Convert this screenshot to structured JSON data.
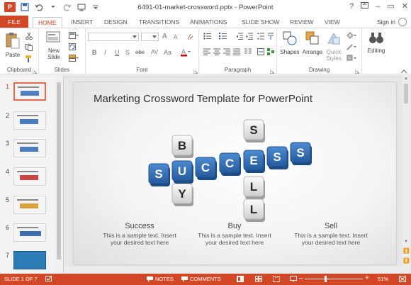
{
  "window": {
    "doc_title": "6491-01-market-crossword.pptx - PowerPoint",
    "help": "?",
    "minimize": "–",
    "restore": "▭",
    "close": "✕"
  },
  "tabs": [
    {
      "label": "FILE"
    },
    {
      "label": "HOME"
    },
    {
      "label": "INSERT"
    },
    {
      "label": "DESIGN"
    },
    {
      "label": "TRANSITIONS"
    },
    {
      "label": "ANIMATIONS"
    },
    {
      "label": "SLIDE SHOW"
    },
    {
      "label": "REVIEW"
    },
    {
      "label": "VIEW"
    }
  ],
  "account": {
    "signin": "Sign in"
  },
  "ribbon": {
    "clipboard": {
      "label": "Clipboard",
      "paste": "Paste"
    },
    "slides": {
      "label": "Slides",
      "new_slide_1": "New",
      "new_slide_2": "Slide"
    },
    "font": {
      "label": "Font",
      "bold": "B",
      "italic": "I",
      "underline": "U",
      "strike": "S",
      "shadow": "abc",
      "spacing": "AV",
      "case": "Aa",
      "grow": "A",
      "shrink": "A"
    },
    "paragraph": {
      "label": "Paragraph"
    },
    "drawing": {
      "label": "Drawing",
      "shapes": "Shapes",
      "arrange": "Arrange",
      "quick_1": "Quick",
      "quick_2": "Styles"
    },
    "editing": {
      "label": "Editing"
    }
  },
  "thumbnails": [
    {
      "num": "1"
    },
    {
      "num": "2"
    },
    {
      "num": "3"
    },
    {
      "num": "4"
    },
    {
      "num": "5"
    },
    {
      "num": "6"
    },
    {
      "num": "7"
    }
  ],
  "slide": {
    "title": "Marketing Crossword Template for PowerPoint",
    "words": {
      "success": [
        "S",
        "U",
        "C",
        "C",
        "E",
        "S",
        "S"
      ],
      "buy": [
        "B",
        "Y"
      ],
      "sell": [
        "S",
        "L",
        "L"
      ]
    },
    "columns": [
      {
        "title": "Success",
        "line1": "This is a sample text. Insert",
        "line2": "your desired text here"
      },
      {
        "title": "Buy",
        "line1": "This is a sample text. Insert",
        "line2": "your desired text here"
      },
      {
        "title": "Sell",
        "line1": "This is a sample text. Insert",
        "line2": "your desired text here"
      }
    ]
  },
  "status": {
    "slide_of": "SLIDE 1 OF 7",
    "notes": "NOTES",
    "comments": "COMMENTS",
    "zoom": "51%",
    "zoom_minus": "–",
    "zoom_plus": "+"
  },
  "colors": {
    "accent": "#d24726",
    "tile_blue": "#2f6db4",
    "tile_gray": "#e9e9e9"
  }
}
